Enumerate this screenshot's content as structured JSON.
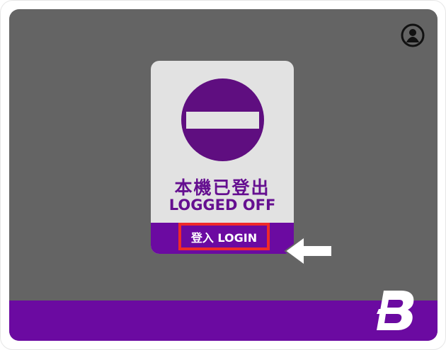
{
  "card": {
    "title_zh": "本機已登出",
    "title_en": "LOGGED OFF",
    "login_label": "登入 LOGIN"
  },
  "icons": {
    "profile": "user-circle-icon",
    "status": "no-entry-icon",
    "pointer": "arrow-left-icon",
    "brand": "b-logo-icon"
  },
  "colors": {
    "background": "#646464",
    "card": "#e2e2e2",
    "accent": "#6b0aa1",
    "highlight": "#ef2a2a",
    "text": "#650f90"
  }
}
